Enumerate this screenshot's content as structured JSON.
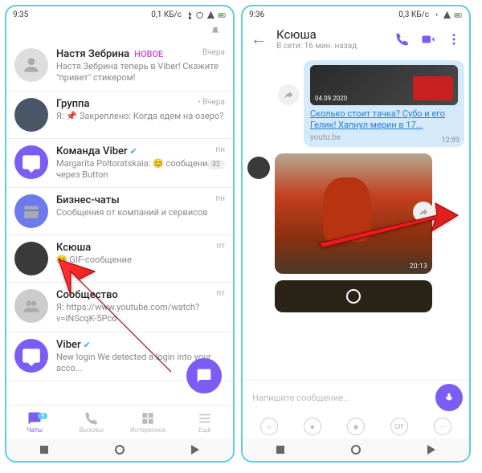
{
  "p1": {
    "time": "9:35",
    "net": "0,1 КБ/с",
    "chats": [
      {
        "name": "Настя Зебрина",
        "badge": "НОВОЕ",
        "sub": "Настя Зебрина теперь в Viber! Скажите \"привет\" стикером!",
        "time": "Вчера"
      },
      {
        "name": "Группа",
        "sub": "Я: 📌 Закреплено: Когда едем на озеро?",
        "time": "• Вчера"
      },
      {
        "name": "Команда Viber",
        "verified": true,
        "sub": "Margarita Poltoratskaia: 😊 сообщение через Button",
        "time": "пн",
        "badge2": "32"
      },
      {
        "name": "Бизнес-чаты",
        "sub": "Сообщения от компаний и сервисов",
        "time": "пн"
      },
      {
        "name": "Ксюша",
        "sub": "😊 GIF-сообщение",
        "time": "пт"
      },
      {
        "name": "Сообщество",
        "sub": "Я: https://www.youtube.com/watch?v=INScqK-5Pco",
        "time": "пт"
      },
      {
        "name": "Viber",
        "verified": true,
        "sub": "New login\nWe detected a login into your acco..."
      }
    ],
    "nav": {
      "chats": "Чаты",
      "calls": "Вызовы",
      "more": "Интересное",
      "settings": "Ещё",
      "badge": "9"
    }
  },
  "p2": {
    "time": "9:36",
    "net": "0,3 КБ/с",
    "name": "Ксюша",
    "status": "В сети: 16 мин. назад",
    "date": "04.09.2020",
    "link_title": "Сколько стоит тачка? Субо и его Гелик! Хапнул мерин в 17...",
    "link_src": "youtu.be",
    "msg_time": "12:59",
    "gif_dur": "20:13",
    "placeholder": "Напишите сообщение...",
    "gif_label": "GIF"
  }
}
